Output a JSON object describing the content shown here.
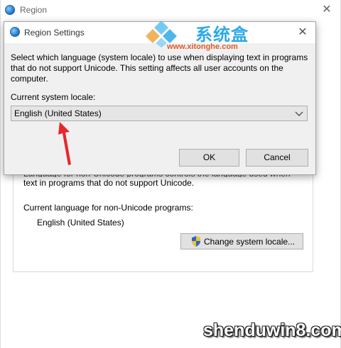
{
  "region_window": {
    "title": "Region",
    "close_glyph": "✕",
    "panel": {
      "desc_cut": "Language for non-Unicode programs controls the language used when displaying",
      "desc_line2": "text in programs that do not support Unicode.",
      "current_label": "Current language for non-Unicode programs:",
      "current_value": "English (United States)",
      "change_button": "Change system locale..."
    }
  },
  "dialog": {
    "title": "Region Settings",
    "close_glyph": "✕",
    "description": "Select which language (system locale) to use when displaying text in programs that do not support Unicode. This setting affects all user accounts on the computer.",
    "locale_label": "Current system locale:",
    "locale_value": "English (United States)",
    "ok_label": "OK",
    "cancel_label": "Cancel"
  },
  "watermarks": {
    "top_cn": "系统盒",
    "top_url": "www.xitonghe.com",
    "bottom": "shenduwin8.com"
  },
  "icons": {
    "app": "globe-icon",
    "shield": "uac-shield-icon",
    "dropdown": "chevron-down-icon"
  },
  "colors": {
    "annotation_arrow": "#e8262b",
    "watermark_blue": "#2ea9e6",
    "watermark_orange": "#e05a2a"
  }
}
